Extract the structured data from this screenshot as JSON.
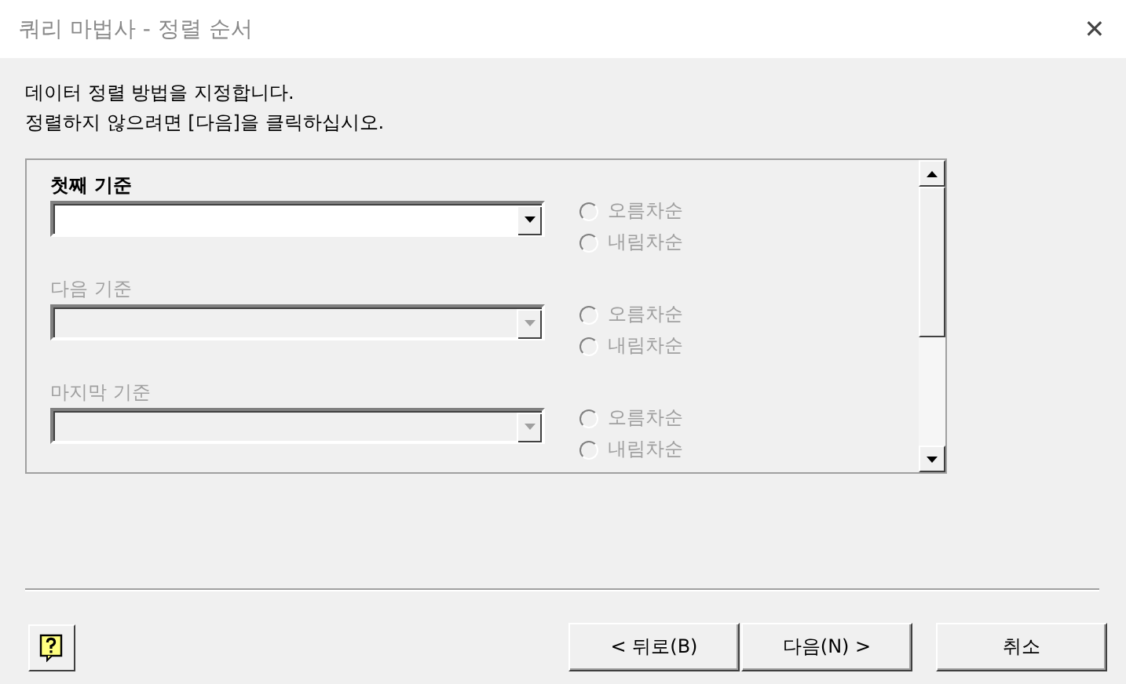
{
  "window": {
    "title": "쿼리 마법사 - 정렬 순서",
    "close": "✕"
  },
  "instructions": [
    "데이터 정렬 방법을 지정합니다.",
    "정렬하지 않으려면 [다음]을 클릭하십시오."
  ],
  "sort_levels": [
    {
      "label": "첫째 기준",
      "disabled": false,
      "options": [
        {
          "label": "오름차순",
          "selected": false,
          "disabled": true
        },
        {
          "label": "내림차순",
          "selected": false,
          "disabled": true
        }
      ]
    },
    {
      "label": "다음 기준",
      "disabled": true,
      "options": [
        {
          "label": "오름차순",
          "selected": false,
          "disabled": true
        },
        {
          "label": "내림차순",
          "selected": false,
          "disabled": true
        }
      ]
    },
    {
      "label": "마지막 기준",
      "disabled": true,
      "options": [
        {
          "label": "오름차순",
          "selected": false,
          "disabled": true
        },
        {
          "label": "내림차순",
          "selected": false,
          "disabled": true
        }
      ]
    }
  ],
  "buttons": [
    {
      "label": "< 뒤로(B)"
    },
    {
      "label": "다음(N) >"
    },
    {
      "label": "취소"
    }
  ]
}
